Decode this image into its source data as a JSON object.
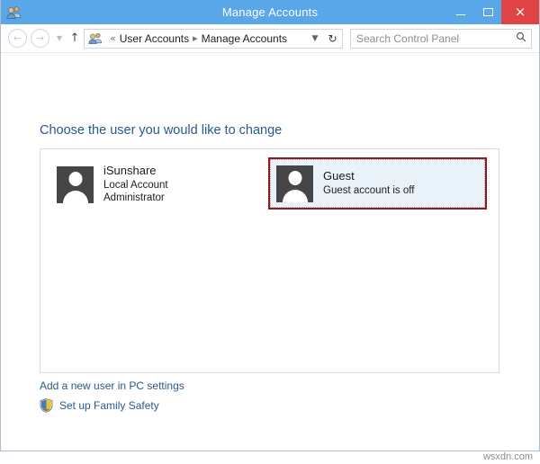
{
  "window": {
    "title": "Manage Accounts",
    "icon": "user-accounts-icon",
    "buttons": {
      "minimize": "minimize-icon",
      "maximize": "maximize-icon",
      "close": "×"
    }
  },
  "navbar": {
    "back": "←",
    "forward": "→",
    "recent_caret": "▼",
    "up": "↑",
    "breadcrumb_icon": "user-accounts-icon",
    "breadcrumb_prefix": "«",
    "breadcrumb": [
      {
        "label": "User Accounts"
      },
      {
        "label": "Manage Accounts"
      }
    ],
    "breadcrumb_separator": "▸",
    "address_dropdown": "▼",
    "refresh": "↻",
    "search": {
      "placeholder": "Search Control Panel",
      "value": "",
      "icon": "⌕"
    }
  },
  "main": {
    "heading": "Choose the user you would like to change",
    "accounts": [
      {
        "name": "iSunshare",
        "line2": "Local Account",
        "line3": "Administrator",
        "selected": false,
        "highlighted": false
      },
      {
        "name": "Guest",
        "line2": "Guest account is off",
        "line3": "",
        "selected": true,
        "highlighted": true
      }
    ],
    "links": [
      {
        "label": "Add a new user in PC settings",
        "icon": ""
      },
      {
        "label": "Set up Family Safety",
        "icon": "shield-icon"
      }
    ]
  },
  "colors": {
    "titlebar": "#59a7e8",
    "close_button": "#e04343",
    "heading": "#2a5a8c",
    "link": "#2a5a8c",
    "selection_fill": "#eaf2fa",
    "annotation_border": "#8f1a17",
    "avatar": "#464646"
  },
  "watermark": "wsxdn.com"
}
